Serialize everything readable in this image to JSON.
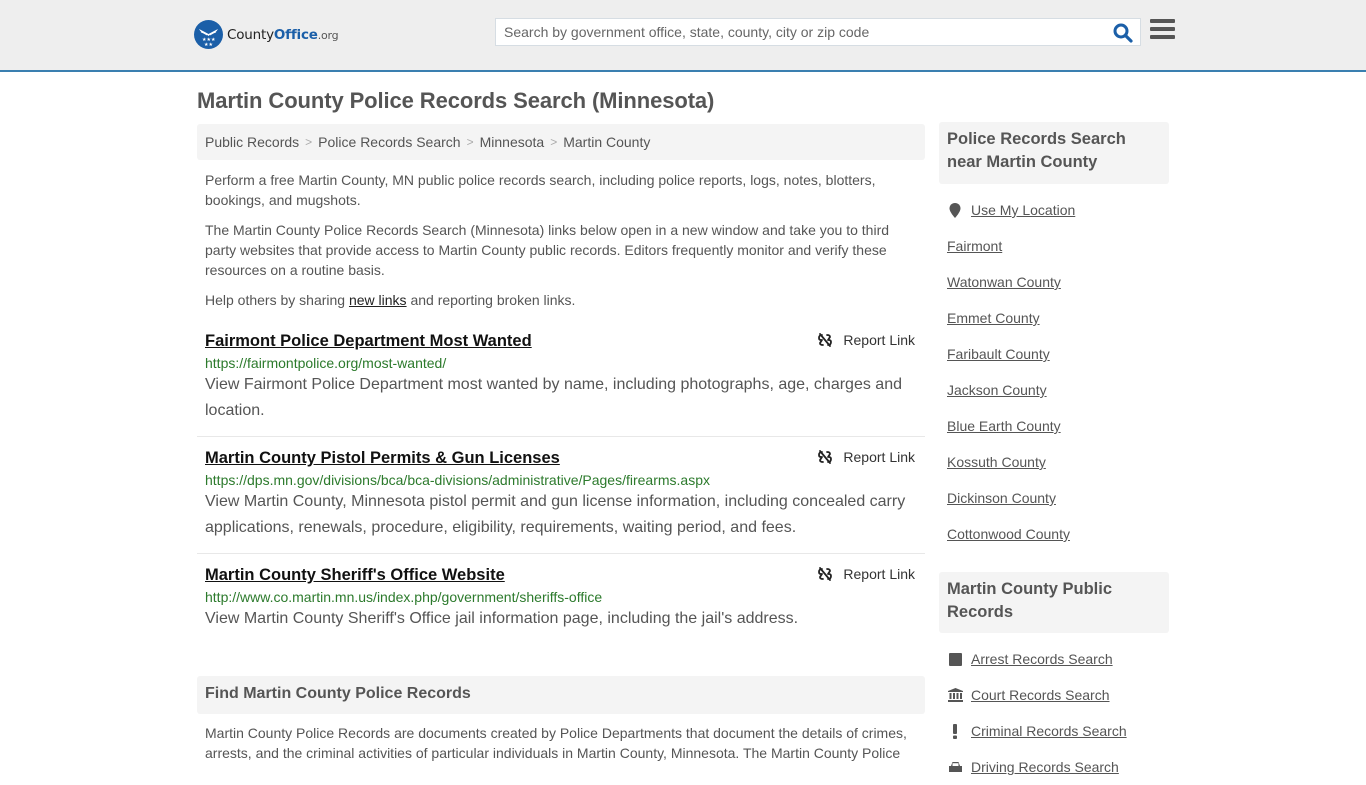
{
  "header": {
    "logo": {
      "part1": "County",
      "part2": "Office",
      "part3": ".org"
    },
    "search_placeholder": "Search by government office, state, county, city or zip code",
    "search_value": ""
  },
  "page": {
    "title": "Martin County Police Records Search (Minnesota)",
    "breadcrumb": [
      "Public Records",
      "Police Records Search",
      "Minnesota",
      "Martin County"
    ],
    "intro": {
      "p1": "Perform a free Martin County, MN public police records search, including police reports, logs, notes, blotters, bookings, and mugshots.",
      "p2": "The Martin County Police Records Search (Minnesota) links below open in a new window and take you to third party websites that provide access to Martin County public records. Editors frequently monitor and verify these resources on a routine basis.",
      "p3_before": "Help others by sharing ",
      "p3_link": "new links",
      "p3_after": " and reporting broken links."
    },
    "results": [
      {
        "title": "Fairmont Police Department Most Wanted",
        "url": "https://fairmontpolice.org/most-wanted/",
        "description": "View Fairmont Police Department most wanted by name, including photographs, age, charges and location.",
        "report_label": "Report Link"
      },
      {
        "title": "Martin County Pistol Permits & Gun Licenses",
        "url": "https://dps.mn.gov/divisions/bca/bca-divisions/administrative/Pages/firearms.aspx",
        "description": "View Martin County, Minnesota pistol permit and gun license information, including concealed carry applications, renewals, procedure, eligibility, requirements, waiting period, and fees.",
        "report_label": "Report Link"
      },
      {
        "title": "Martin County Sheriff's Office Website",
        "url": "http://www.co.martin.mn.us/index.php/government/sheriffs-office",
        "description": "View Martin County Sheriff's Office jail information page, including the jail's address.",
        "report_label": "Report Link"
      }
    ],
    "find_section": {
      "heading": "Find Martin County Police Records",
      "text": "Martin County Police Records are documents created by Police Departments that document the details of crimes, arrests, and the criminal activities of particular individuals in Martin County, Minnesota. The Martin County Police"
    }
  },
  "sidebar": {
    "near": {
      "heading": "Police Records Search near Martin County",
      "use_location": "Use My Location",
      "items": [
        "Fairmont",
        "Watonwan County",
        "Emmet County",
        "Faribault County",
        "Jackson County",
        "Blue Earth County",
        "Kossuth County",
        "Dickinson County",
        "Cottonwood County"
      ]
    },
    "public_records": {
      "heading": "Martin County Public Records",
      "items": [
        {
          "label": "Arrest Records Search",
          "icon": "square-icon"
        },
        {
          "label": "Court Records Search",
          "icon": "courthouse-icon"
        },
        {
          "label": "Criminal Records Search",
          "icon": "exclamation-icon"
        },
        {
          "label": "Driving Records Search",
          "icon": "car-icon"
        }
      ]
    }
  },
  "colors": {
    "brand_blue": "#1b5fa8",
    "header_border": "#3a7fb0",
    "url_green": "#2c7a2c"
  }
}
